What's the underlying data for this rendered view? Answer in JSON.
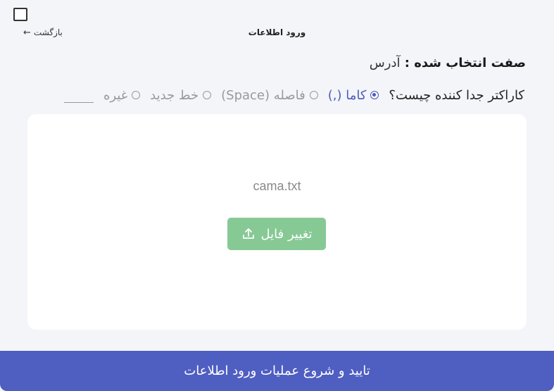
{
  "header": {
    "back_label": "بازگشت",
    "title": "ورود اطلاعات"
  },
  "field": {
    "label": "صفت انتخاب شده :",
    "value": "آدرس"
  },
  "separator": {
    "question": "کاراکتر جدا کننده چیست؟",
    "options": [
      {
        "label": "کاما (,)",
        "selected": true
      },
      {
        "label": "فاصله (Space)",
        "selected": false
      },
      {
        "label": "خط جدید",
        "selected": false
      },
      {
        "label": "غیره",
        "selected": false
      }
    ],
    "other_value": ""
  },
  "file": {
    "name": "cama.txt",
    "change_label": "تغییر فایل"
  },
  "submit_label": "تایید و شروع عملیات ورود اطلاعات",
  "colors": {
    "accent": "#4f5ec1",
    "selected_option": "#4b5bbd",
    "change_button": "#86c995",
    "background": "#f4f5f9"
  },
  "icons": {
    "close": "square-icon",
    "back": "arrow-left-icon",
    "upload": "upload-icon"
  }
}
